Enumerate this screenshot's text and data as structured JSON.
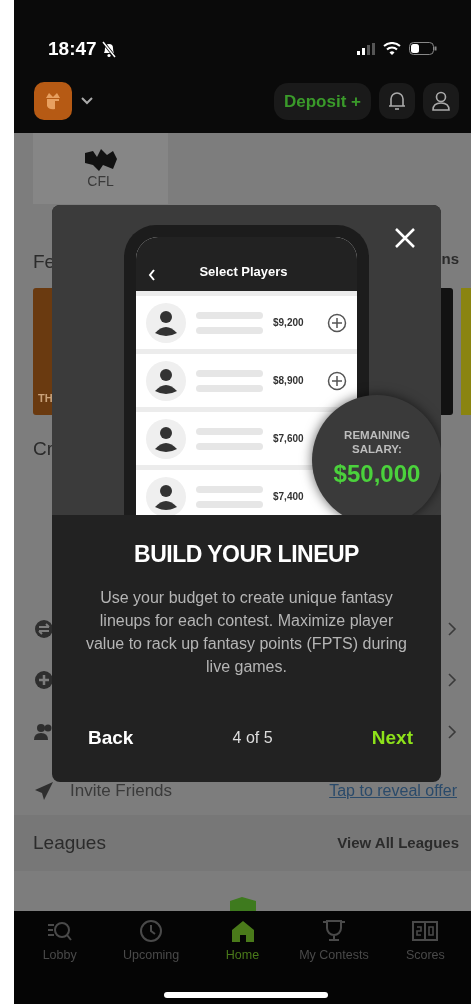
{
  "status_bar": {
    "time": "18:47"
  },
  "header": {
    "deposit": "Deposit +"
  },
  "background": {
    "sport_tile": "CFL",
    "featured_title": "Fe",
    "featured_link": "ns",
    "card_text": "TH",
    "create_title": "Cr",
    "invite": {
      "label": "Invite Friends",
      "action": "Tap to reveal offer"
    },
    "leagues_title": "Leagues",
    "leagues_link": "View All Leagues"
  },
  "modal": {
    "screen_title": "Select Players",
    "players": [
      {
        "salary": "$9,200",
        "add_button": true
      },
      {
        "salary": "$8,900",
        "add_button": true
      },
      {
        "salary": "$7,600",
        "add_button": false
      },
      {
        "salary": "$7,400",
        "add_button": false
      }
    ],
    "salary_label": "REMAINING SALARY:",
    "salary_value": "$50,000",
    "title": "BUILD YOUR LINEUP",
    "body": "Use your budget to create unique fantasy lineups for each contest. Maximize player value to rack up fantasy points (FPTS) during live games.",
    "back": "Back",
    "step": "4 of 5",
    "next": "Next"
  },
  "tabs": [
    {
      "label": "Lobby",
      "kind": "lobby",
      "selected": false
    },
    {
      "label": "Upcoming",
      "kind": "upcoming",
      "selected": false
    },
    {
      "label": "Home",
      "kind": "home",
      "selected": true
    },
    {
      "label": "My Contests",
      "kind": "contests",
      "selected": false
    },
    {
      "label": "Scores",
      "kind": "scores",
      "selected": false
    }
  ]
}
